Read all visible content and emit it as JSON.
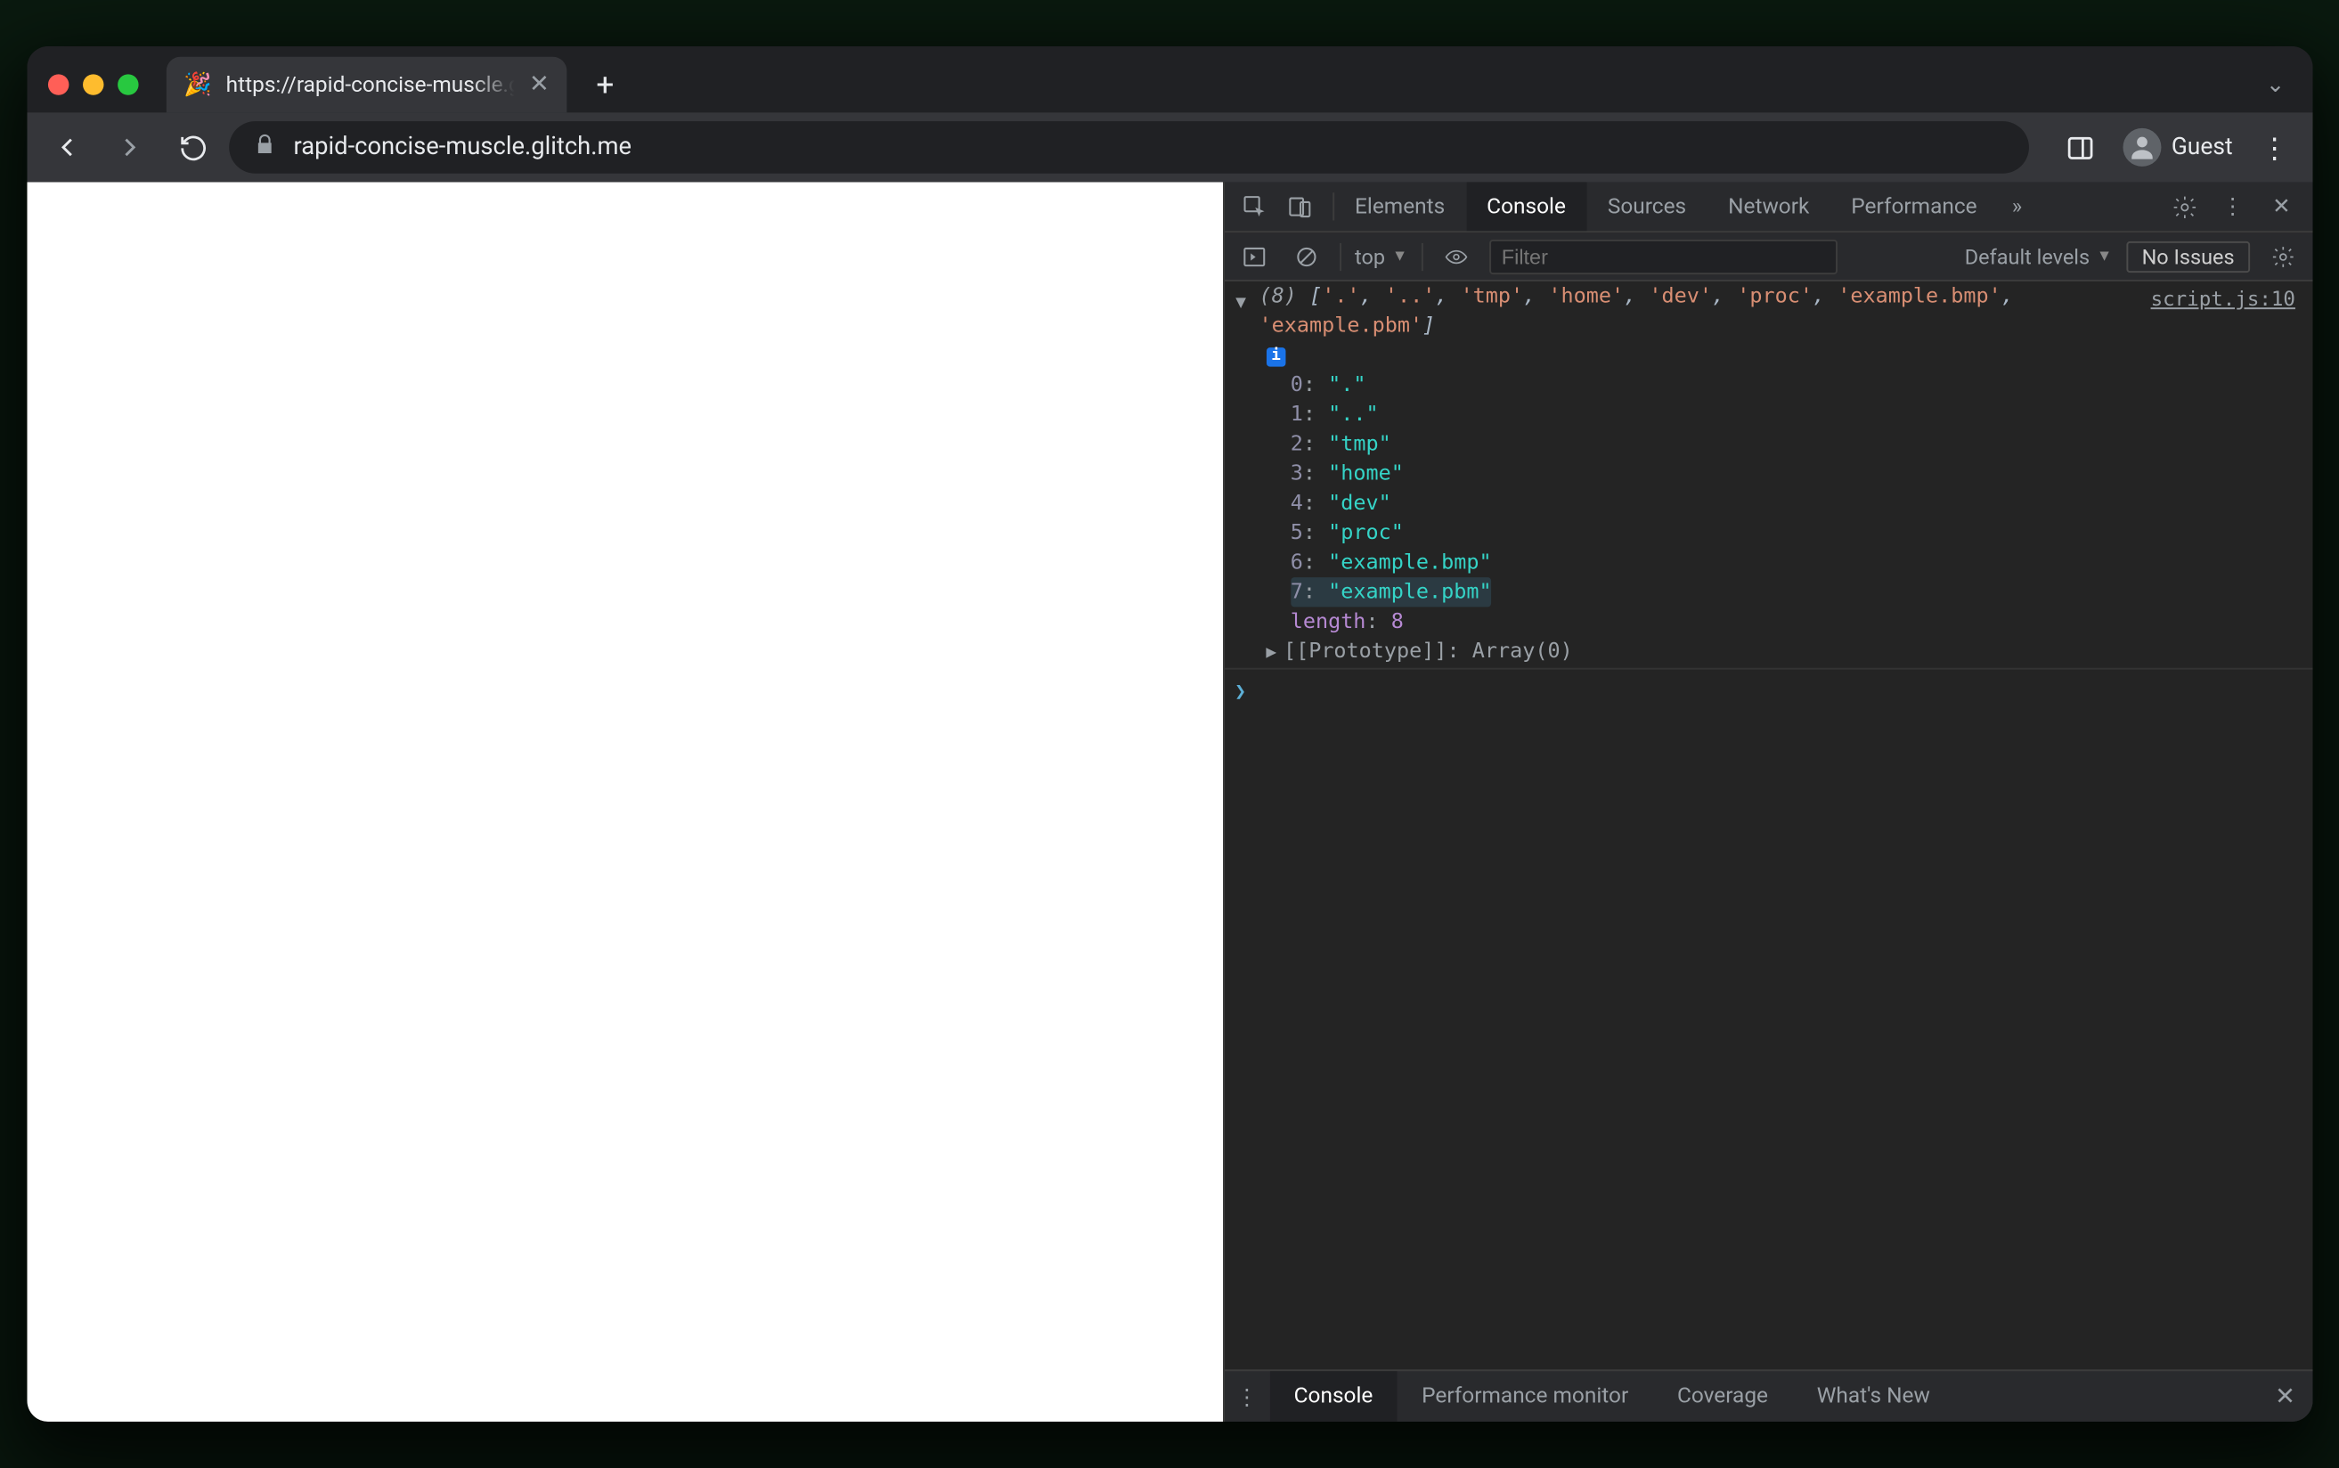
{
  "browser": {
    "tab": {
      "favicon": "🎉",
      "title": "https://rapid-concise-muscle.g"
    },
    "url": "rapid-concise-muscle.glitch.me",
    "guest_label": "Guest"
  },
  "devtools": {
    "tabs": [
      "Elements",
      "Console",
      "Sources",
      "Network",
      "Performance"
    ],
    "active_tab": "Console",
    "more_glyph": "»",
    "console_toolbar": {
      "context": "top",
      "filter_placeholder": "Filter",
      "levels_label": "Default levels",
      "issues_label": "No Issues"
    },
    "source_link": "script.js:10",
    "array": {
      "count": "(8)",
      "summary": [
        "'.'",
        "'..'",
        "'tmp'",
        "'home'",
        "'dev'",
        "'proc'",
        "'example.bmp'",
        "'example.pbm'"
      ],
      "items": [
        {
          "idx": "0",
          "val": "\".\""
        },
        {
          "idx": "1",
          "val": "\"..\""
        },
        {
          "idx": "2",
          "val": "\"tmp\""
        },
        {
          "idx": "3",
          "val": "\"home\""
        },
        {
          "idx": "4",
          "val": "\"dev\""
        },
        {
          "idx": "5",
          "val": "\"proc\""
        },
        {
          "idx": "6",
          "val": "\"example.bmp\""
        },
        {
          "idx": "7",
          "val": "\"example.pbm\""
        }
      ],
      "length_key": "length",
      "length_val": "8",
      "proto_label": "[[Prototype]]",
      "proto_val": "Array(0)"
    },
    "drawer_tabs": [
      "Console",
      "Performance monitor",
      "Coverage",
      "What's New"
    ],
    "drawer_active": "Console"
  }
}
